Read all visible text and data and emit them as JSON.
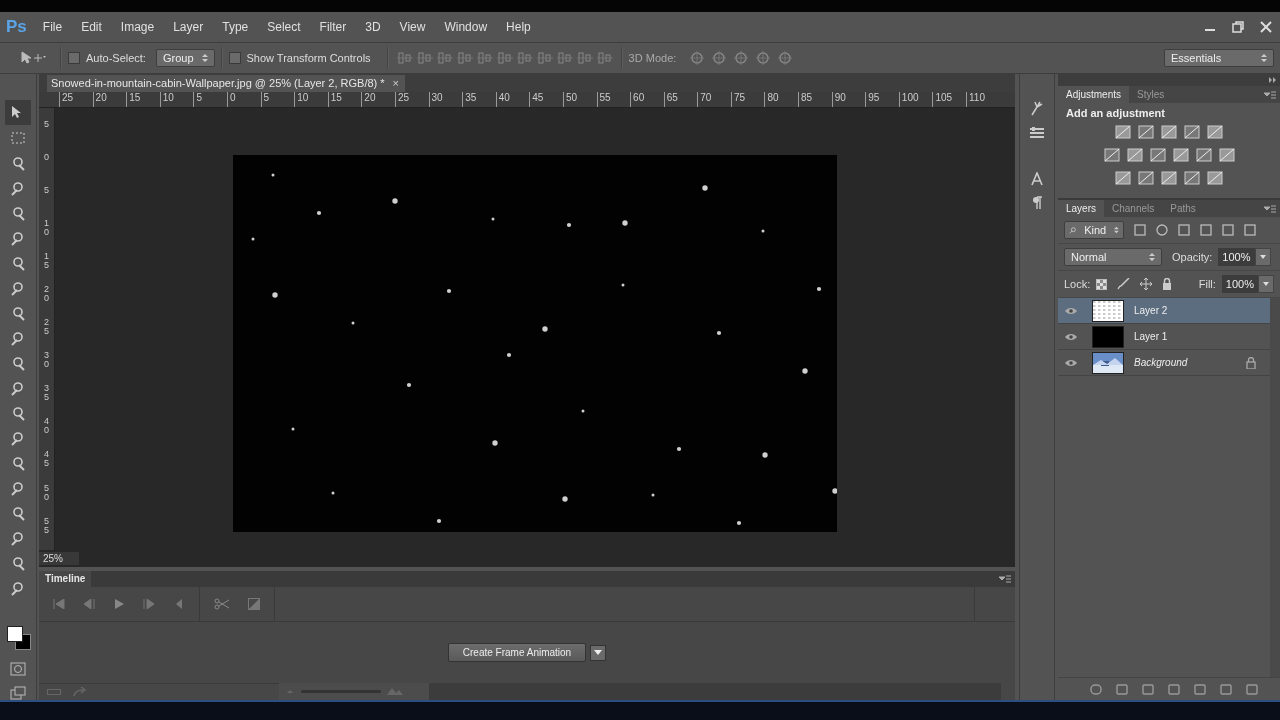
{
  "app_logo": "Ps",
  "menu": [
    "File",
    "Edit",
    "Image",
    "Layer",
    "Type",
    "Select",
    "Filter",
    "3D",
    "View",
    "Window",
    "Help"
  ],
  "options_bar": {
    "auto_select": {
      "label": "Auto-Select:",
      "checked": false
    },
    "auto_select_target": "Group",
    "show_transform": {
      "label": "Show Transform Controls",
      "checked": false
    },
    "three_d_mode_label": "3D Mode:",
    "workspace": "Essentials"
  },
  "document_tab": {
    "title": "Snowed-in-mountain-cabin-Wallpaper.jpg @ 25% (Layer 2, RGB/8) *",
    "close": "×"
  },
  "ruler_horizontal": [
    "25",
    "20",
    "15",
    "10",
    "5",
    "0",
    "5",
    "10",
    "15",
    "20",
    "25",
    "30",
    "35",
    "40",
    "45",
    "50",
    "55",
    "60",
    "65",
    "70",
    "75",
    "80",
    "85",
    "90",
    "95",
    "100",
    "105",
    "110"
  ],
  "ruler_vertical": [
    "5",
    "0",
    "5",
    "10",
    "15",
    "20",
    "25",
    "30",
    "35",
    "40",
    "45",
    "50",
    "55"
  ],
  "zoom_status": "25%",
  "timeline": {
    "title": "Timeline",
    "create_button": "Create Frame Animation"
  },
  "adjustments_panel": {
    "tabs": [
      {
        "label": "Adjustments",
        "selected": true
      },
      {
        "label": "Styles",
        "selected": false
      }
    ],
    "heading": "Add an adjustment"
  },
  "layers_panel": {
    "tabs": [
      {
        "label": "Layers",
        "selected": true
      },
      {
        "label": "Channels",
        "selected": false
      },
      {
        "label": "Paths",
        "selected": false
      }
    ],
    "filter": "Kind",
    "blend_mode": "Normal",
    "opacity_label": "Opacity:",
    "opacity": "100%",
    "lock_label": "Lock:",
    "fill_label": "Fill:",
    "fill": "100%",
    "layers": [
      {
        "name": "Layer 2",
        "kind": "transparent",
        "selected": true,
        "visible": true,
        "locked": false
      },
      {
        "name": "Layer 1",
        "kind": "black",
        "selected": false,
        "visible": true,
        "locked": false
      },
      {
        "name": "Background",
        "kind": "background",
        "selected": false,
        "visible": true,
        "locked": true
      }
    ]
  }
}
